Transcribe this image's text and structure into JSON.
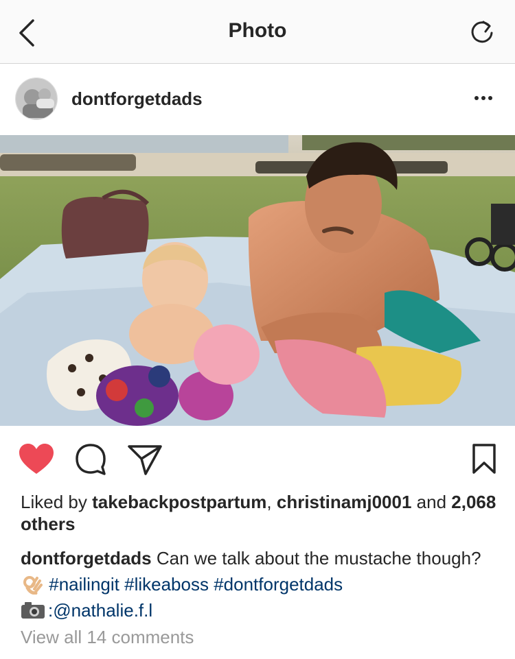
{
  "navbar": {
    "title": "Photo",
    "back_icon": "chevron-left-icon",
    "refresh_icon": "refresh-icon"
  },
  "post": {
    "username": "dontforgetdads",
    "more_icon": "more-horizontal-icon",
    "photo_subject": "shirtless father lying on a picnic blanket with a baby and toys"
  },
  "actions": {
    "like_icon": "heart-filled-icon",
    "comment_icon": "comment-icon",
    "share_icon": "share-icon",
    "save_icon": "bookmark-icon",
    "like_color": "#ed4956"
  },
  "likes": {
    "prefix": "Liked by",
    "user1": "takebackpostpartum",
    "separator": ",",
    "user2": "christinamj0001",
    "and": "and",
    "others": "2,068 others"
  },
  "caption": {
    "username": "dontforgetdads",
    "text": "Can we talk about the mustache though?",
    "emoji": "ok-hand-emoji",
    "hashtags": [
      "#nailingit",
      "#likeaboss",
      "#dontforgetdads"
    ],
    "camera_emoji": "camera-emoji",
    "credit": ":@nathalie.f.l"
  },
  "comments": {
    "view_all": "View all 14 comments"
  },
  "colors": {
    "link": "#003569",
    "muted": "#999999",
    "text": "#262626"
  }
}
